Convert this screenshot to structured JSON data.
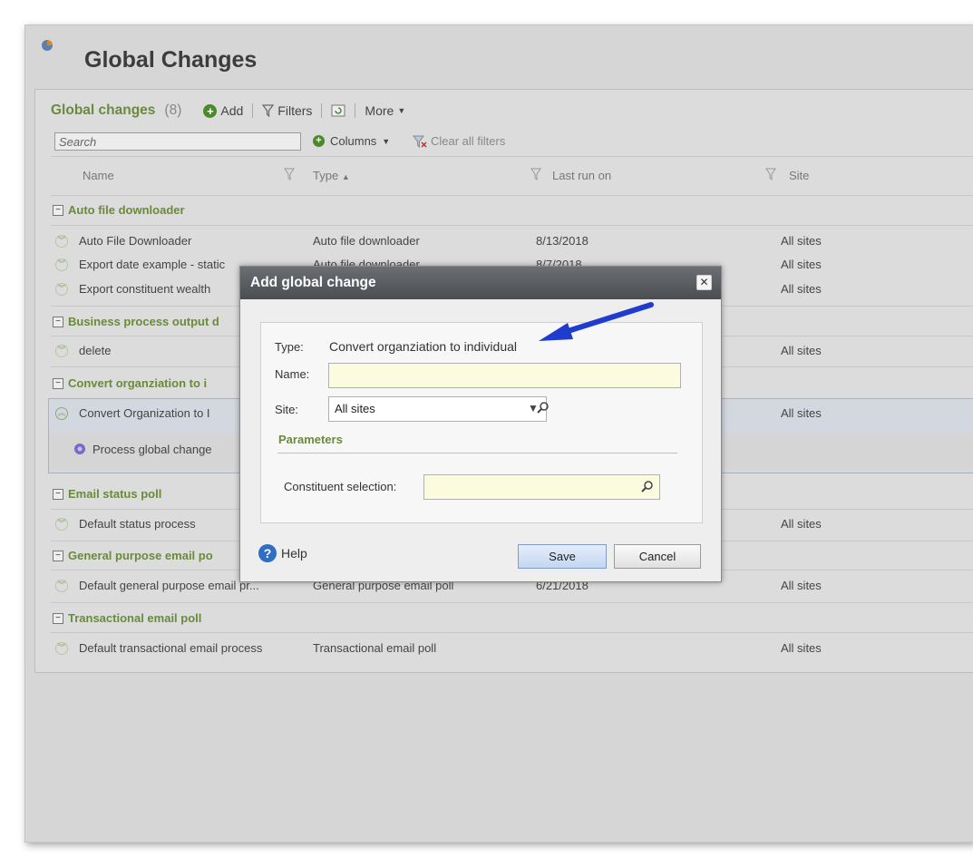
{
  "page": {
    "title": "Global Changes"
  },
  "toolbar": {
    "title": "Global changes",
    "count": "(8)",
    "add": "Add",
    "filters": "Filters",
    "more": "More"
  },
  "search": {
    "placeholder": "Search",
    "columns": "Columns",
    "clear_filters": "Clear all filters"
  },
  "table": {
    "headers": [
      "Name",
      "Type",
      "Last run on",
      "Site"
    ],
    "sort_indicator": "▲",
    "groups": [
      {
        "name": "Auto file downloader",
        "rows": [
          {
            "name": "Auto File Downloader",
            "type": "Auto file downloader",
            "last_run": "8/13/2018",
            "site": "All sites"
          },
          {
            "name": "Export date example - static",
            "type": "Auto file downloader",
            "last_run": "8/7/2018",
            "site": "All sites"
          },
          {
            "name": "Export constituent wealth",
            "type": "",
            "last_run": "",
            "site": "All sites"
          }
        ]
      },
      {
        "name": "Business process output d",
        "rows": [
          {
            "name": "delete",
            "type": "",
            "last_run": "",
            "site": "All sites"
          }
        ]
      },
      {
        "name": "Convert organziation to i",
        "rows": [
          {
            "name": "Convert Organization to I",
            "type": "",
            "last_run": "",
            "site": "All sites"
          }
        ]
      },
      {
        "name": "Email status poll",
        "rows": [
          {
            "name": "Default status process",
            "type": "",
            "last_run": "",
            "site": "All sites"
          }
        ]
      },
      {
        "name": "General purpose email po",
        "rows": [
          {
            "name": "Default general purpose email pr...",
            "type": "General purpose email poll",
            "last_run": "6/21/2018",
            "site": "All sites"
          }
        ]
      },
      {
        "name": "Transactional email poll",
        "rows": [
          {
            "name": "Default transactional email process",
            "type": "Transactional email poll",
            "last_run": "",
            "site": "All sites"
          }
        ]
      }
    ],
    "action": "Process global change"
  },
  "dialog": {
    "title": "Add global change",
    "type_label": "Type:",
    "type_value": "Convert organziation to individual",
    "name_label": "Name:",
    "name_value": "",
    "site_label": "Site:",
    "site_value": "All sites",
    "parameters": "Parameters",
    "constituent_label": "Constituent selection:",
    "constituent_value": "",
    "help": "Help",
    "save": "Save",
    "cancel": "Cancel"
  },
  "colors": {
    "accent_green": "#6a8a3c",
    "arrow": "#1f3ccf",
    "field_yellow": "#fbfbe0",
    "title_bar": "#55585d"
  }
}
